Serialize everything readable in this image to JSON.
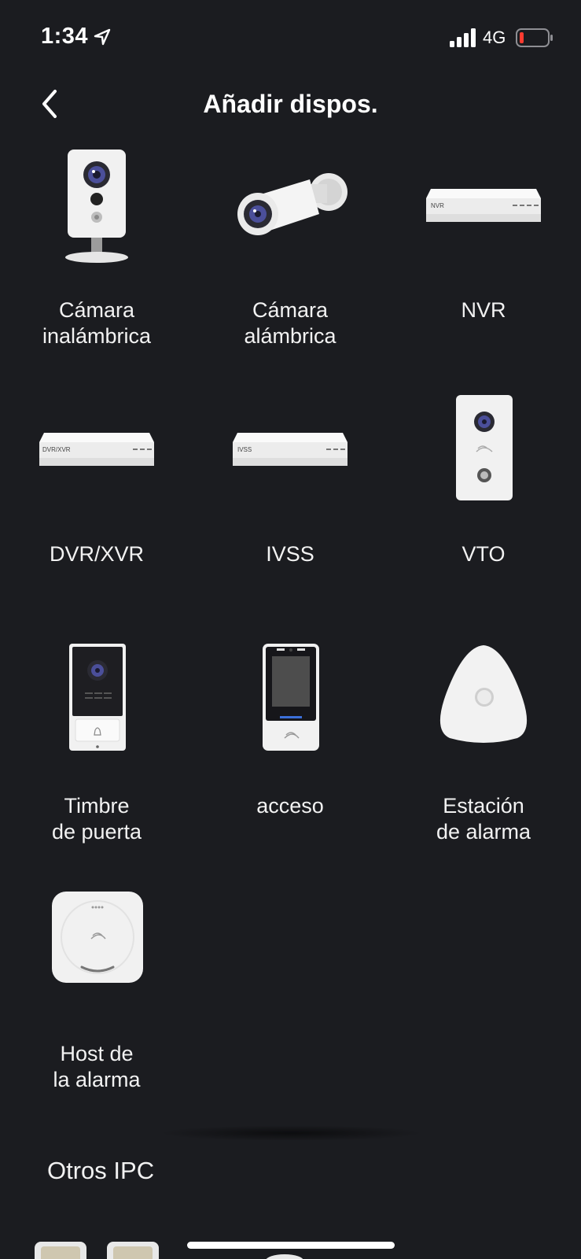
{
  "status_bar": {
    "time": "1:34",
    "network": "4G",
    "battery_color": "#ff3b30"
  },
  "header": {
    "title": "Añadir dispos.",
    "back_icon": "chevron-left-icon"
  },
  "devices": [
    {
      "label": "Cámara\ninalámbrica",
      "icon": "wireless-camera-icon"
    },
    {
      "label": "Cámara\nalámbrica",
      "icon": "bullet-camera-icon"
    },
    {
      "label": "NVR",
      "icon": "nvr-recorder-icon",
      "device_text": "NVR"
    },
    {
      "label": "DVR/XVR",
      "icon": "dvr-recorder-icon",
      "device_text": "DVR/XVR"
    },
    {
      "label": "IVSS",
      "icon": "ivss-recorder-icon",
      "device_text": "IVSS"
    },
    {
      "label": "VTO",
      "icon": "vto-intercom-icon"
    },
    {
      "label": "Timbre\nde puerta",
      "icon": "doorbell-icon"
    },
    {
      "label": "acceso",
      "icon": "access-control-icon"
    },
    {
      "label": "Estación\nde alarma",
      "icon": "alarm-station-icon"
    },
    {
      "label": "Host de\nla alarma",
      "icon": "alarm-host-icon"
    }
  ],
  "section": {
    "title": "Otros IPC"
  },
  "colors": {
    "background": "#1b1c20",
    "text": "#ffffff",
    "device_body": "#f1f1f1"
  }
}
